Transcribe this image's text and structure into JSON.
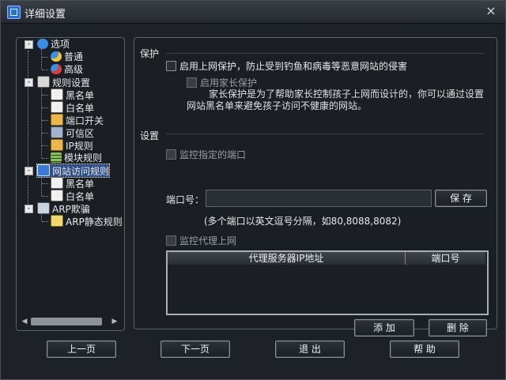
{
  "window": {
    "title": "详细设置"
  },
  "tree": {
    "items": [
      {
        "label": "选项"
      },
      {
        "label": "普通"
      },
      {
        "label": "高级"
      },
      {
        "label": "规则设置"
      },
      {
        "label": "黑名单"
      },
      {
        "label": "白名单"
      },
      {
        "label": "端口开关"
      },
      {
        "label": "可信区"
      },
      {
        "label": "IP规则"
      },
      {
        "label": "模块规则"
      },
      {
        "label": "网站访问规则"
      },
      {
        "label": "黑名单"
      },
      {
        "label": "白名单"
      },
      {
        "label": "ARP欺骗"
      },
      {
        "label": "ARP静态规则"
      }
    ],
    "expander_symbol": "-"
  },
  "protect": {
    "title": "保护",
    "enable_label": "启用上网保护，防止受到钓鱼和病毒等恶意网站的侵害",
    "parent_label": "启用家长保护",
    "desc_line1": "家长保护是为了帮助家长控制孩子上网而设计的，你可以通过设置",
    "desc_line2": "网站黑名单来避免孩子访问不健康的网站。"
  },
  "settings": {
    "title": "设置",
    "monitor_port_label": "监控指定的端口",
    "port_label": "端口号：",
    "port_value": "",
    "save_label": "保 存",
    "hint": "(多个端口以英文逗号分隔，如80,8088,8082)",
    "monitor_proxy_label": "监控代理上网",
    "table_headers": [
      "代理服务器IP地址",
      "端口号"
    ],
    "add_label": "添 加",
    "delete_label": "删 除"
  },
  "footer": {
    "prev_label": "上一页",
    "next_label": "下一页",
    "exit_label": "退 出",
    "help_label": "帮 助"
  },
  "icons": {
    "close": "×"
  }
}
